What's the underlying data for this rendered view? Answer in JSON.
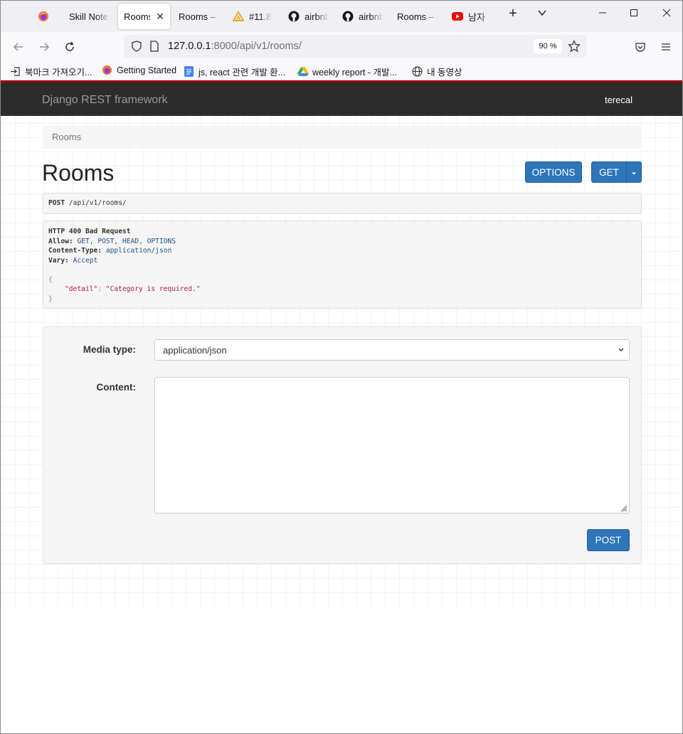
{
  "browser": {
    "tabs": [
      {
        "label": "",
        "icon": "firefox-icon"
      },
      {
        "label": "Skill Note",
        "icon": ""
      },
      {
        "label": "Rooms",
        "icon": "",
        "active": true
      },
      {
        "label": "Rooms – D",
        "icon": ""
      },
      {
        "label": "#11.8",
        "icon": "warning-triangle-icon"
      },
      {
        "label": "airbnb",
        "icon": "github-icon"
      },
      {
        "label": "airbnb",
        "icon": "github-icon"
      },
      {
        "label": "Rooms – D",
        "icon": ""
      },
      {
        "label": "남자",
        "icon": "youtube-icon"
      }
    ],
    "url_host": "127.0.0.1",
    "url_rest": ":8000/api/v1/rooms/",
    "zoom": "90 %",
    "bookmarks": [
      {
        "label": "북마크 가져오기...",
        "icon": "import-icon"
      },
      {
        "label": "Getting Started",
        "icon": "firefox-icon"
      },
      {
        "label": "js, react 관련 개발 환...",
        "icon": "docs-icon"
      },
      {
        "label": "weekly report - 개발...",
        "icon": "drive-icon"
      },
      {
        "label": "내 동영상",
        "icon": "globe-icon"
      }
    ]
  },
  "drf": {
    "brand": "Django REST framework",
    "user": "terecal",
    "breadcrumb": "Rooms",
    "title": "Rooms",
    "options_label": "OPTIONS",
    "get_label": "GET",
    "request_method": "POST",
    "request_path": "/api/v1/rooms/",
    "response": {
      "status": "HTTP 400 Bad Request",
      "allow_label": "Allow:",
      "allow_value": "GET, POST, HEAD, OPTIONS",
      "content_type_label": "Content-Type:",
      "content_type_value": "application/json",
      "vary_label": "Vary:",
      "vary_value": "Accept",
      "open_brace": "{",
      "close_brace": "}",
      "key": "\"detail\"",
      "colon": ":",
      "value": "\"Category is required.\""
    },
    "form": {
      "media_type_label": "Media type:",
      "media_type_value": "application/json",
      "content_label": "Content:",
      "content_value": "",
      "post_label": "POST"
    }
  },
  "colors": {
    "accent": "#2c76b9",
    "navbar": "#2c2c2c",
    "navbar_border": "#a30000"
  }
}
